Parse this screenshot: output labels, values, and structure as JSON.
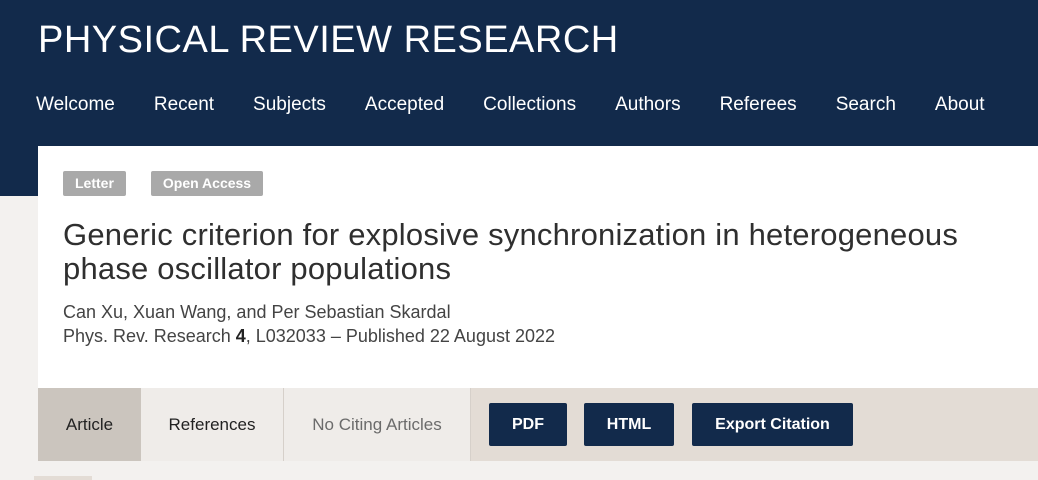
{
  "header": {
    "site_title": "PHYSICAL REVIEW RESEARCH",
    "nav": [
      "Welcome",
      "Recent",
      "Subjects",
      "Accepted",
      "Collections",
      "Authors",
      "Referees",
      "Search",
      "About"
    ]
  },
  "article": {
    "badges": [
      "Letter",
      "Open Access"
    ],
    "title": "Generic criterion for explosive synchronization in heterogeneous phase oscillator populations",
    "authors": "Can Xu, Xuan Wang, and Per Sebastian Skardal",
    "citation": {
      "journal": "Phys. Rev. Research ",
      "volume": "4",
      "rest": ", L032033 – Published 22 August 2022"
    }
  },
  "tabs": {
    "article": "Article",
    "references": "References",
    "citing": "No Citing Articles"
  },
  "buttons": {
    "pdf": "PDF",
    "html": "HTML",
    "export": "Export Citation"
  },
  "colors": {
    "navy": "#122a4b",
    "badge_gray": "#a9a9a9",
    "tabbar": "#e3dcd5"
  }
}
